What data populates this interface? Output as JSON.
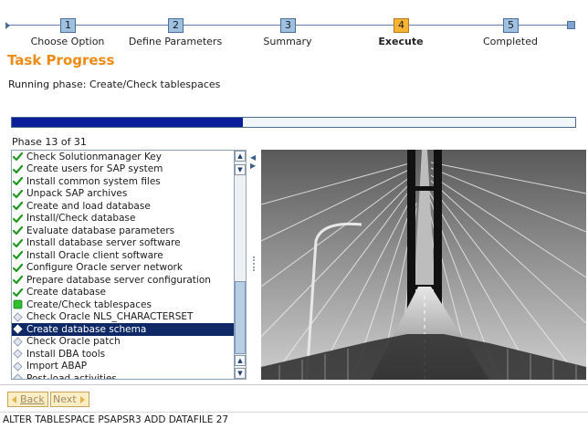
{
  "roadmap": {
    "steps": [
      {
        "number": "1",
        "label": "Choose Option"
      },
      {
        "number": "2",
        "label": "Define Parameters"
      },
      {
        "number": "3",
        "label": "Summary"
      },
      {
        "number": "4",
        "label": "Execute",
        "active": true
      },
      {
        "number": "5",
        "label": "Completed"
      }
    ]
  },
  "header": {
    "title": "Task Progress",
    "running_phase": "Running phase: Create/Check tablespaces"
  },
  "progress": {
    "fraction": 0.41,
    "phase_count": "Phase 13 of 31"
  },
  "phase_list": {
    "items": [
      {
        "label": "Check Solutionmanager Key",
        "status": "done"
      },
      {
        "label": "Create users for SAP system",
        "status": "done"
      },
      {
        "label": "Install common system files",
        "status": "done"
      },
      {
        "label": "Unpack SAP archives",
        "status": "done"
      },
      {
        "label": "Create and load database",
        "status": "done"
      },
      {
        "label": "Install/Check database",
        "status": "done"
      },
      {
        "label": "Evaluate database parameters",
        "status": "done"
      },
      {
        "label": "Install database server software",
        "status": "done"
      },
      {
        "label": "Install Oracle client software",
        "status": "done"
      },
      {
        "label": "Configure Oracle server network",
        "status": "done"
      },
      {
        "label": "Prepare database server configuration",
        "status": "done"
      },
      {
        "label": "Create database",
        "status": "done"
      },
      {
        "label": "Create/Check tablespaces",
        "status": "running"
      },
      {
        "label": "Check Oracle NLS_CHARACTERSET",
        "status": "pending"
      },
      {
        "label": "Create database schema",
        "status": "pending",
        "selected": true
      },
      {
        "label": "Check Oracle patch",
        "status": "pending"
      },
      {
        "label": "Install DBA tools",
        "status": "pending"
      },
      {
        "label": "Import ABAP",
        "status": "pending"
      },
      {
        "label": "Post-load activities",
        "status": "pending"
      }
    ]
  },
  "buttons": {
    "back_label": "Back",
    "next_label": "Next"
  },
  "status_bar": {
    "text": "ALTER TABLESPACE PSAPSR3 ADD DATAFILE 27"
  },
  "colors": {
    "title": "#ef8a13",
    "progress_fill": "#0c1d9a",
    "step_active": "#f7b334",
    "step_inactive": "#9ec1e2",
    "selection": "#0f2967",
    "done_check": "#1e9a1e",
    "running_square": "#2fbf2f"
  }
}
